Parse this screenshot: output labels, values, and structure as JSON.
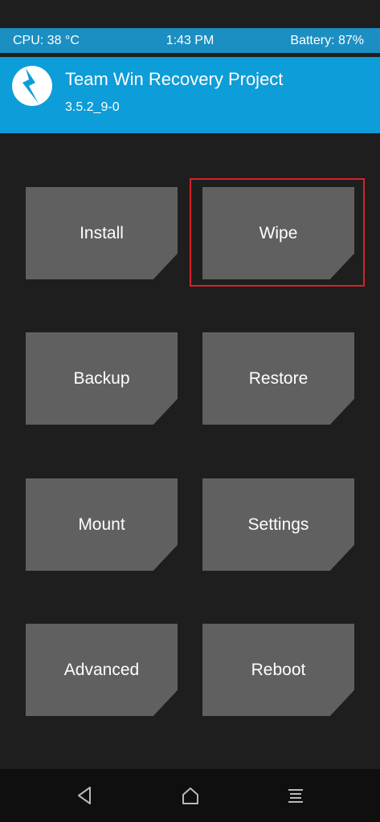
{
  "status": {
    "cpu": "CPU: 38 °C",
    "time": "1:43 PM",
    "battery": "Battery: 87%"
  },
  "header": {
    "title": "Team Win Recovery Project",
    "version": "3.5.2_9-0"
  },
  "menu": [
    {
      "label": "Install"
    },
    {
      "label": "Wipe"
    },
    {
      "label": "Backup"
    },
    {
      "label": "Restore"
    },
    {
      "label": "Mount"
    },
    {
      "label": "Settings"
    },
    {
      "label": "Advanced"
    },
    {
      "label": "Reboot"
    }
  ],
  "colors": {
    "accent": "#0d9dd8",
    "status_bar": "#1b8fc2",
    "tile": "#606060",
    "background": "#1e1e1e",
    "highlight": "#d72328"
  },
  "navigation": {
    "icons": [
      "back-icon",
      "home-icon",
      "menu-icon"
    ]
  }
}
